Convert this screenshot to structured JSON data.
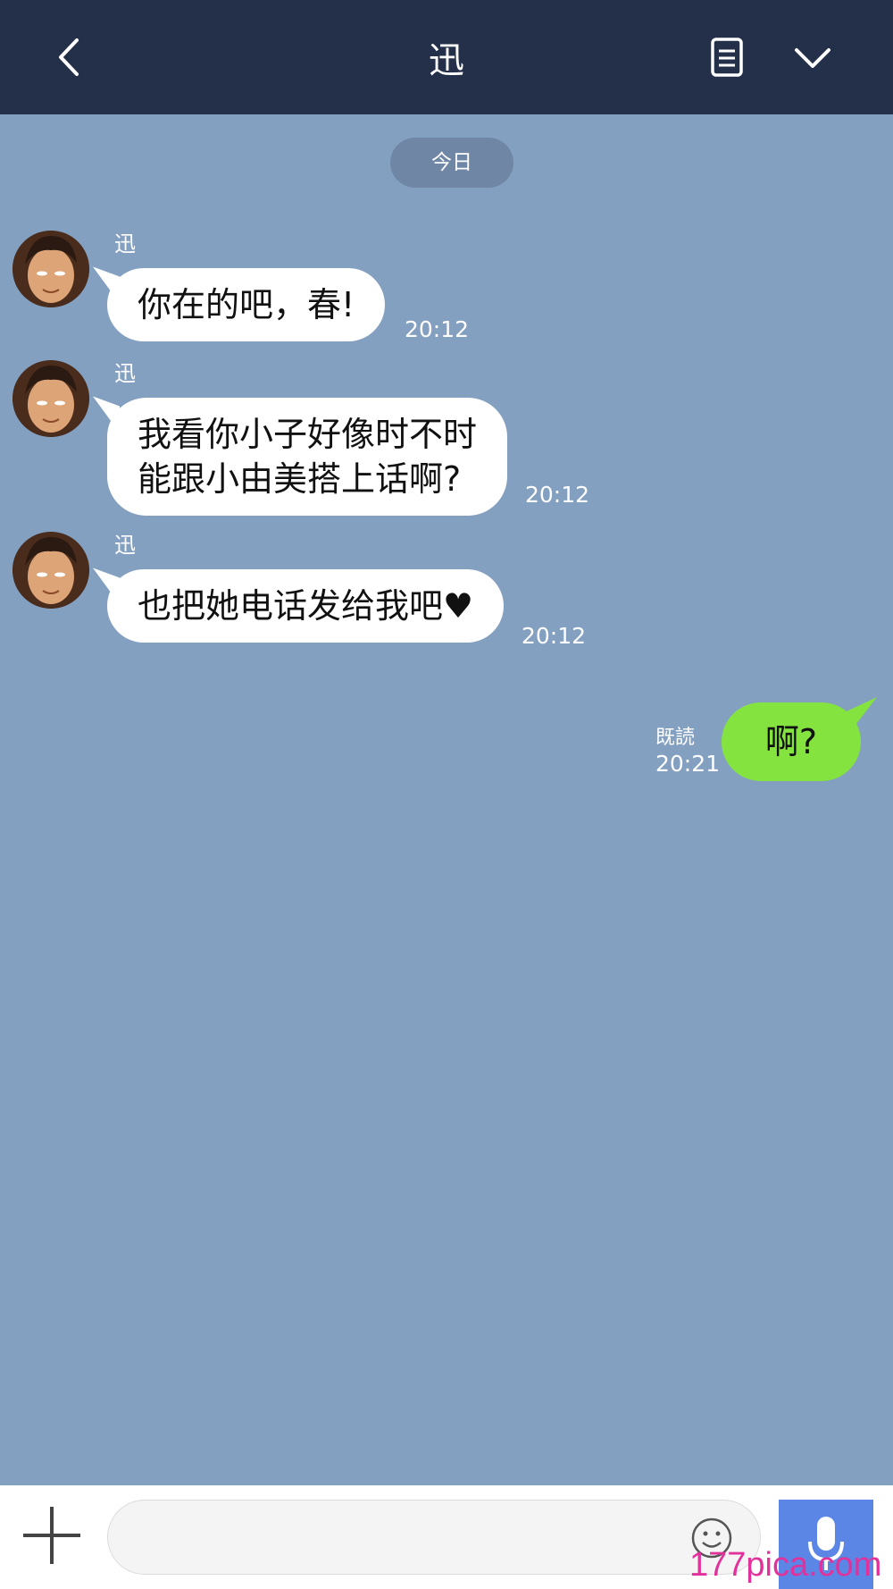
{
  "header": {
    "title": "迅",
    "back_icon": "chevron-left-icon",
    "notes_icon": "notes-icon",
    "menu_icon": "chevron-down-icon"
  },
  "date_separator": "今日",
  "messages": [
    {
      "sender": "迅",
      "text": "你在的吧，春!",
      "time": "20:12"
    },
    {
      "sender": "迅",
      "text": "我看你小子好像时不时\n能跟小由美搭上话啊?",
      "time": "20:12"
    },
    {
      "sender": "迅",
      "text": "也把她电话发给我吧♥",
      "time": "20:12"
    }
  ],
  "outgoing": {
    "text": "啊?",
    "read_label": "既読",
    "time": "20:21"
  },
  "input": {
    "placeholder": "",
    "value": ""
  },
  "colors": {
    "header_bg": "#243049",
    "chat_bg": "#84a0c1",
    "outgoing_bubble": "#84e33f",
    "mic_button": "#5b86e5",
    "watermark": "#e1329c"
  },
  "watermark": "177pica.com"
}
